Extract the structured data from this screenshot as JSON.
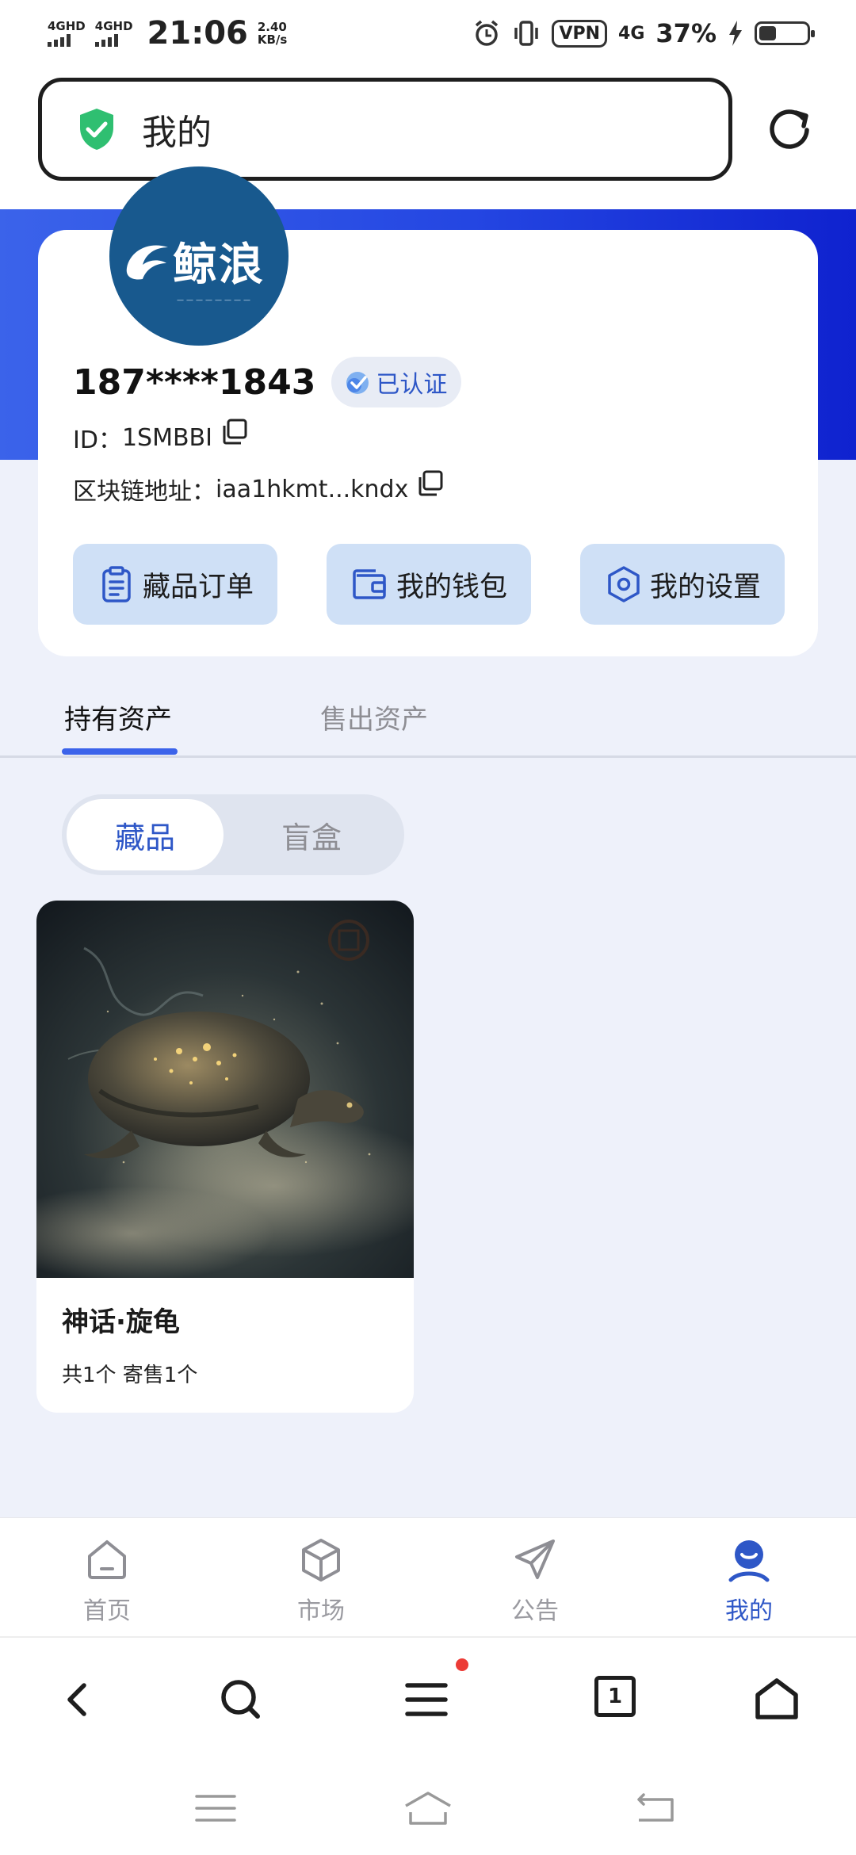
{
  "status_bar": {
    "sim1": "4GHD",
    "sim2": "4GHD",
    "time": "21:06",
    "speed_value": "2.40",
    "speed_unit": "KB/s",
    "vpn": "VPN",
    "network": "4G",
    "battery_pct": "37%",
    "battery_level": 0.37
  },
  "address_bar": {
    "text": "我的",
    "icon": "green-shield-icon"
  },
  "profile": {
    "logo_text": "鲸浪",
    "phone": "187****1843",
    "verified_label": "已认证",
    "id_label": "ID：",
    "id_value": "1SMBBI",
    "chain_label": "区块链地址：",
    "chain_value": "iaa1hkmt...kndx"
  },
  "actions": [
    {
      "label": "藏品订单",
      "icon": "clipboard-icon"
    },
    {
      "label": "我的钱包",
      "icon": "wallet-icon"
    },
    {
      "label": "我的设置",
      "icon": "hexagon-settings-icon"
    }
  ],
  "tabs": {
    "held": "持有资产",
    "sold": "售出资产",
    "active": "held"
  },
  "segments": {
    "collectibles": "藏品",
    "blind_box": "盲盒",
    "active": "collectibles"
  },
  "items": [
    {
      "name": "神话·旋龟",
      "meta": "共1个 寄售1个"
    }
  ],
  "bottom_nav": [
    {
      "label": "首页",
      "icon": "home-icon",
      "active": false
    },
    {
      "label": "市场",
      "icon": "cube-icon",
      "active": false
    },
    {
      "label": "公告",
      "icon": "send-icon",
      "active": false
    },
    {
      "label": "我的",
      "icon": "user-smile-icon",
      "active": true
    }
  ],
  "browser_bar": {
    "tab_count": "1",
    "icons": [
      "back-icon",
      "search-icon",
      "menu-icon",
      "tabs-icon",
      "home-icon"
    ]
  },
  "colors": {
    "accent": "#2e57c7",
    "banner_start": "#3b63ea",
    "banner_end": "#0f22cf",
    "action_bg": "#cfe0f6",
    "page_bg": "#eef1fa",
    "shield_green": "#2fbf71",
    "notification_dot": "#ec3b36"
  }
}
